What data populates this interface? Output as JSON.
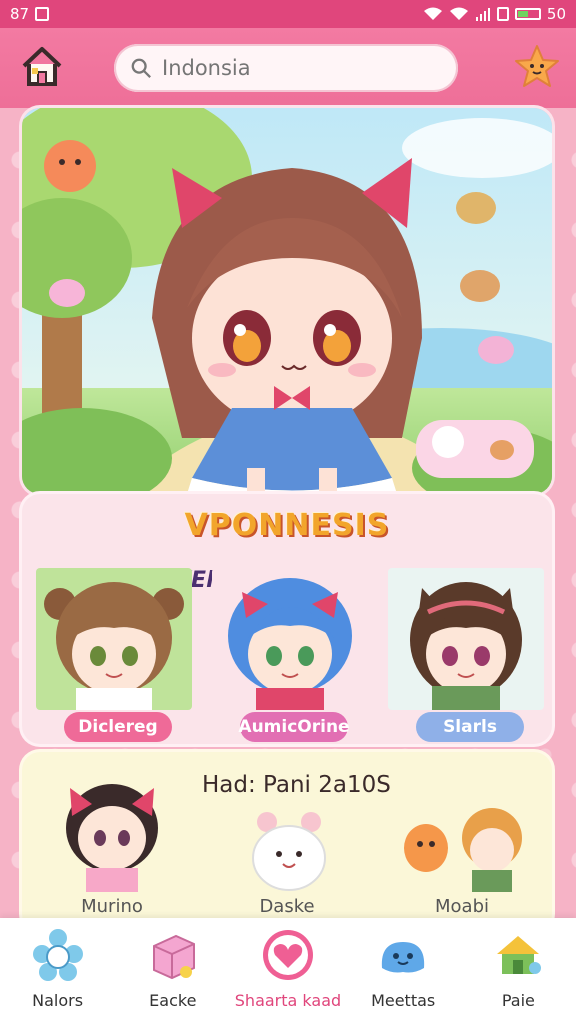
{
  "status_bar": {
    "time": "87",
    "battery_text": "50",
    "battery_level": 0.5
  },
  "header": {
    "search_placeholder": "Indonsia",
    "home_icon": "home-icon",
    "star_icon": "star-icon"
  },
  "featured": {
    "title": "VPONNESIS",
    "badge": "KEloo",
    "characters": [
      {
        "label": "Diclereg",
        "color": "#ef6a98"
      },
      {
        "label": "AumicOrine",
        "color": "#e26fb3"
      },
      {
        "label": "Slarls",
        "color": "#8fb0e8"
      }
    ]
  },
  "lower": {
    "title": "Had: Pani 2a10S",
    "items": [
      {
        "label": "Murino"
      },
      {
        "label": "Daske"
      },
      {
        "label": "Moabi"
      }
    ]
  },
  "nav": [
    {
      "label": "Nalors",
      "icon": "flower-icon"
    },
    {
      "label": "Eacke",
      "icon": "box-icon"
    },
    {
      "label": "Shaarta kaad",
      "icon": "heart-icon",
      "active": true
    },
    {
      "label": "Meettas",
      "icon": "slime-icon"
    },
    {
      "label": "Paie",
      "icon": "house-icon"
    }
  ]
}
